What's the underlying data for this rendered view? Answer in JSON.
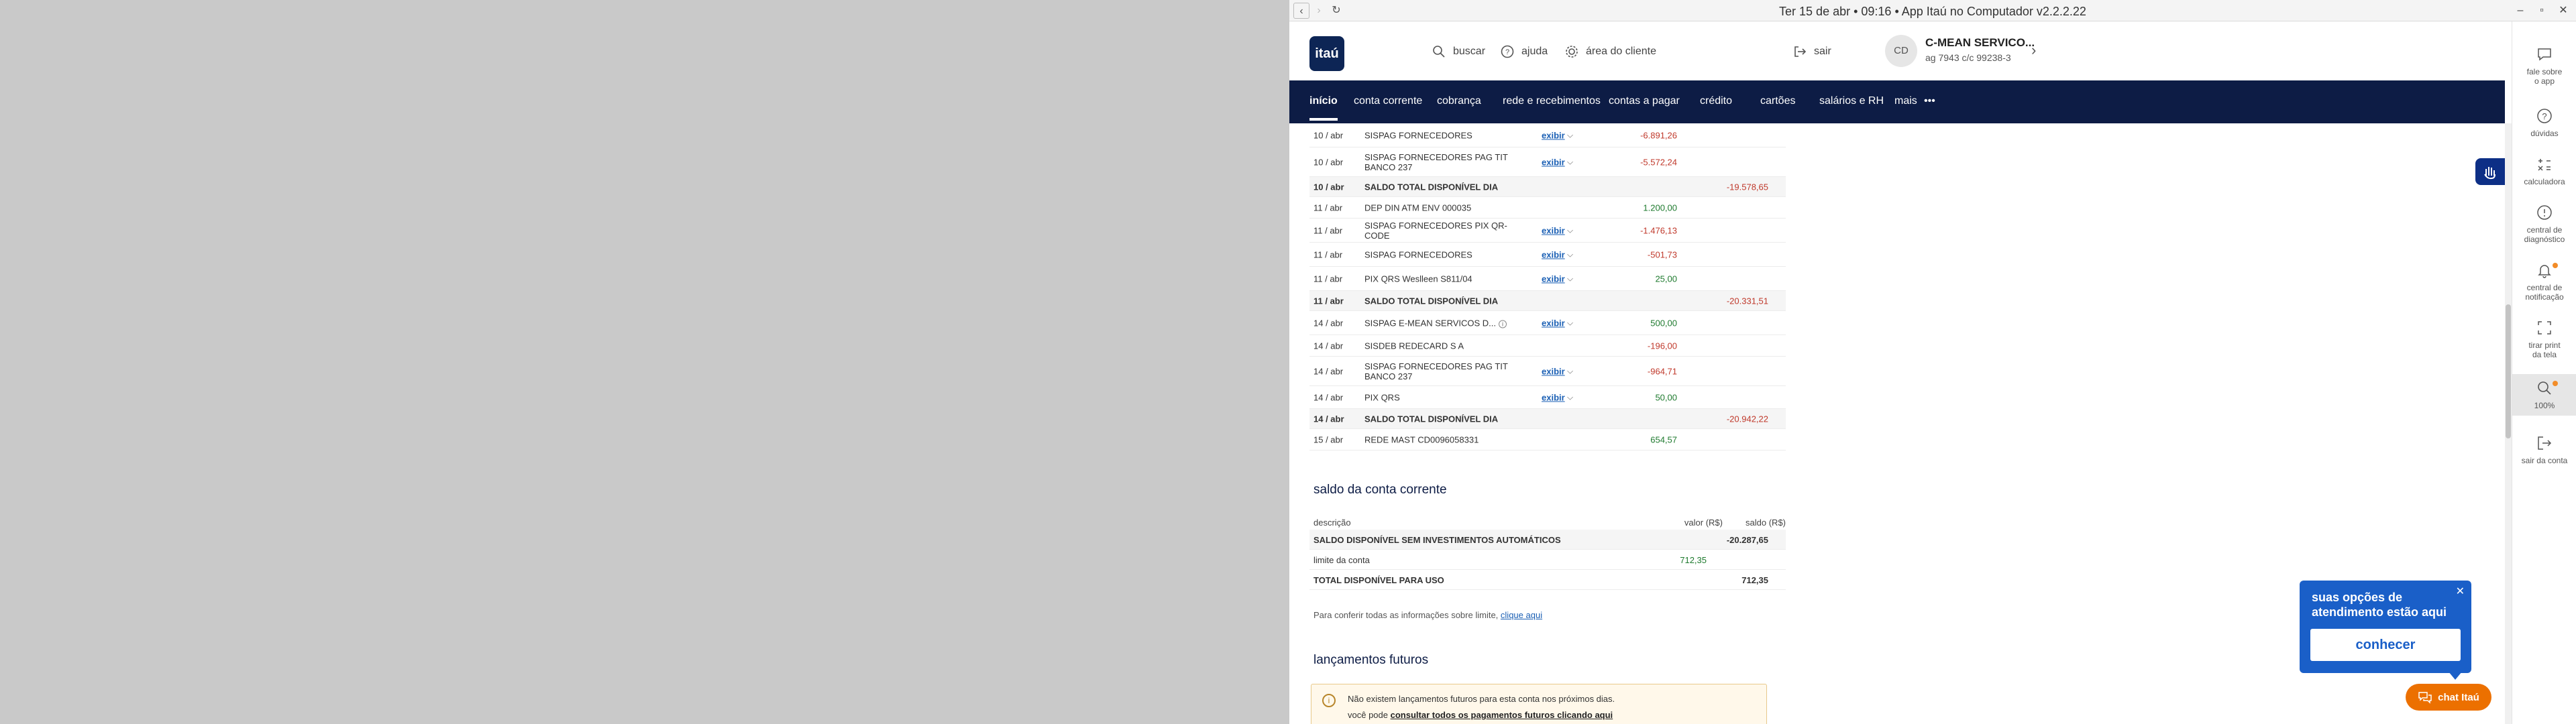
{
  "window": {
    "title": "Ter 15 de abr • 09:16 • App Itaú no Computador v2.2.2.22"
  },
  "header": {
    "logo_text": "itaú",
    "buscar": "buscar",
    "ajuda": "ajuda",
    "area_cliente": "área do cliente",
    "sair": "sair",
    "avatar_initials": "CD",
    "company": "C-MEAN SERVICO...",
    "agcc": "ag 7943   c/c 99238-3"
  },
  "nav": {
    "items": [
      "início",
      "conta corrente",
      "cobrança",
      "rede e recebimentos",
      "contas a pagar",
      "crédito",
      "cartões",
      "salários e RH",
      "mais"
    ]
  },
  "statement": {
    "rows": [
      {
        "date": "10 / abr",
        "desc": "SISPAG FORNECEDORES",
        "exibir": "exibir",
        "value": "-6.891,26",
        "saldo": ""
      },
      {
        "date": "10 / abr",
        "desc": "SISPAG FORNECEDORES PAG TIT BANCO 237",
        "exibir": "exibir",
        "value": "-5.572,24",
        "saldo": ""
      },
      {
        "date": "10 / abr",
        "desc": "SALDO TOTAL DISPONÍVEL DIA",
        "exibir": "",
        "value": "",
        "saldo": "-19.578,65"
      },
      {
        "date": "11 / abr",
        "desc": "DEP DIN ATM ENV 000035",
        "exibir": "",
        "value": "1.200,00",
        "saldo": ""
      },
      {
        "date": "11 / abr",
        "desc": "SISPAG FORNECEDORES PIX QR-CODE",
        "exibir": "exibir",
        "value": "-1.476,13",
        "saldo": ""
      },
      {
        "date": "11 / abr",
        "desc": "SISPAG FORNECEDORES",
        "exibir": "exibir",
        "value": "-501,73",
        "saldo": ""
      },
      {
        "date": "11 / abr",
        "desc": "PIX QRS Weslleen S811/04",
        "exibir": "exibir",
        "value": "25,00",
        "saldo": ""
      },
      {
        "date": "11 / abr",
        "desc": "SALDO TOTAL DISPONÍVEL DIA",
        "exibir": "",
        "value": "",
        "saldo": "-20.331,51"
      },
      {
        "date": "14 / abr",
        "desc": "SISPAG E-MEAN SERVICOS D...",
        "exibir": "exibir",
        "value": "500,00",
        "saldo": ""
      },
      {
        "date": "14 / abr",
        "desc": "SISDEB REDECARD S A",
        "exibir": "",
        "value": "-196,00",
        "saldo": ""
      },
      {
        "date": "14 / abr",
        "desc": "SISPAG FORNECEDORES PAG TIT BANCO 237",
        "exibir": "exibir",
        "value": "-964,71",
        "saldo": ""
      },
      {
        "date": "14 / abr",
        "desc": "PIX QRS",
        "exibir": "exibir",
        "value": "50,00",
        "saldo": ""
      },
      {
        "date": "14 / abr",
        "desc": "SALDO TOTAL DISPONÍVEL DIA",
        "exibir": "",
        "value": "",
        "saldo": "-20.942,22"
      },
      {
        "date": "15 / abr",
        "desc": "REDE MAST CD0096058331",
        "exibir": "",
        "value": "654,57",
        "saldo": ""
      }
    ]
  },
  "saldo_conta": {
    "title": "saldo da conta corrente",
    "col_desc": "descrição",
    "col_valor": "valor (R$)",
    "col_saldo": "saldo (R$)",
    "rows": [
      {
        "label": "SALDO DISPONÍVEL SEM INVESTIMENTOS AUTOMÁTICOS",
        "valor": "",
        "saldo": "-20.287,65"
      },
      {
        "label": "limite da conta",
        "valor": "712,35",
        "saldo": ""
      },
      {
        "label": "TOTAL DISPONÍVEL PARA USO",
        "valor": "",
        "saldo": "712,35"
      }
    ],
    "limit_note": "Para conferir todas as informações sobre limite,",
    "limit_link": "clique aqui"
  },
  "futuros": {
    "title": "lançamentos futuros",
    "line1": "Não existem lançamentos futuros para esta conta nos próximos dias.",
    "line2_prefix": "você pode",
    "line2_link": "consultar todos os pagamentos futuros clicando aqui"
  },
  "rail": {
    "items": [
      {
        "label1": "fale sobre",
        "label2": "o app"
      },
      {
        "label1": "dúvidas",
        "label2": ""
      },
      {
        "label1": "calculadora",
        "label2": ""
      },
      {
        "label1": "central de",
        "label2": "diagnóstico"
      },
      {
        "label1": "central de",
        "label2": "notificação"
      },
      {
        "label1": "tirar print",
        "label2": "da tela"
      },
      {
        "label1": "100%",
        "label2": ""
      },
      {
        "label1": "sair da conta",
        "label2": ""
      }
    ]
  },
  "popup": {
    "title": "suas opções de atendimento estão aqui",
    "button": "conhecer",
    "close": "✕"
  },
  "chat": {
    "label": "chat Itaú"
  },
  "colors": {
    "nav_bg": "#0d1c45",
    "logo_bg": "#0d2555",
    "negative": "#c0392b",
    "positive": "#1e7a2e",
    "popup_bg": "#1a5fc8",
    "chat_bg": "#ec7000"
  }
}
